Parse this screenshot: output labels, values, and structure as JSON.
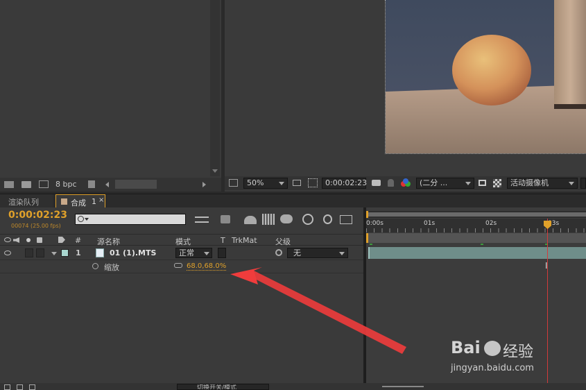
{
  "project_panel": {
    "bit_depth": "8 bpc"
  },
  "viewer": {
    "zoom": "50%",
    "timecode": "0:00:02:23",
    "resolution": "(二分 ...",
    "camera": "活动摄像机"
  },
  "tabs": [
    {
      "label": "渲染队列",
      "active": false
    },
    {
      "label": "合成",
      "suffix": "1",
      "active": true
    }
  ],
  "timeline": {
    "current_time": "0:00:02:23",
    "frame_info": "00074 (25.00 fps)",
    "search_placeholder": "",
    "columns": {
      "hash": "#",
      "source_name": "源名称",
      "mode": "模式",
      "t": "T",
      "trkmat": "TrkMat",
      "parent": "父级"
    },
    "layer": {
      "number": "1",
      "name": "01 (1).MTS",
      "mode": "正常",
      "parent": "无"
    },
    "property": {
      "name": "缩放",
      "value": "68.0,68.0%"
    },
    "ruler": {
      "marks": [
        "0:00s",
        "01s",
        "02s",
        "03s"
      ],
      "playhead_seconds": 2.92
    },
    "footer_label": "切换开关/模式"
  },
  "colors": {
    "accent": "#e0a12a",
    "playhead": "#d23b3b",
    "layer_bar": "#6f8e8a",
    "arrow": "#f03c3c"
  }
}
